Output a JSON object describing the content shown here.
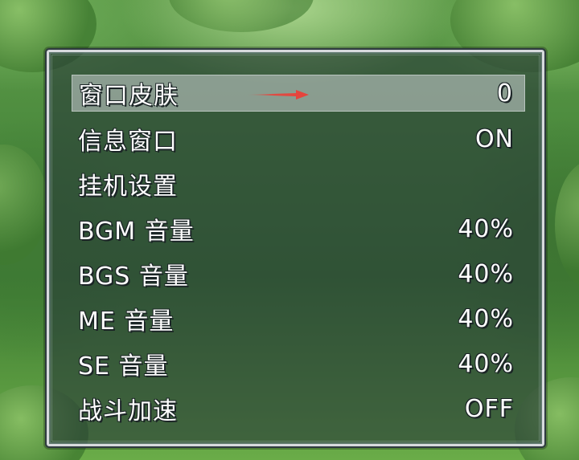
{
  "options_menu": {
    "items": [
      {
        "label": "窗口皮肤",
        "value": "0",
        "selected": true
      },
      {
        "label": "信息窗口",
        "value": "ON"
      },
      {
        "label": "挂机设置",
        "value": ""
      },
      {
        "label": "BGM 音量",
        "value": "40%"
      },
      {
        "label": "BGS 音量",
        "value": "40%"
      },
      {
        "label": "ME 音量",
        "value": "40%"
      },
      {
        "label": "SE 音量",
        "value": "40%"
      },
      {
        "label": "战斗加速",
        "value": "OFF"
      }
    ]
  },
  "colors": {
    "window_fill": "#283a38",
    "window_border": "#d7dadd",
    "selection": "#cdd4d6",
    "text": "#ffffff",
    "arrow": "#e8423a"
  },
  "icons": {
    "pointer": "red-arrow-icon"
  }
}
